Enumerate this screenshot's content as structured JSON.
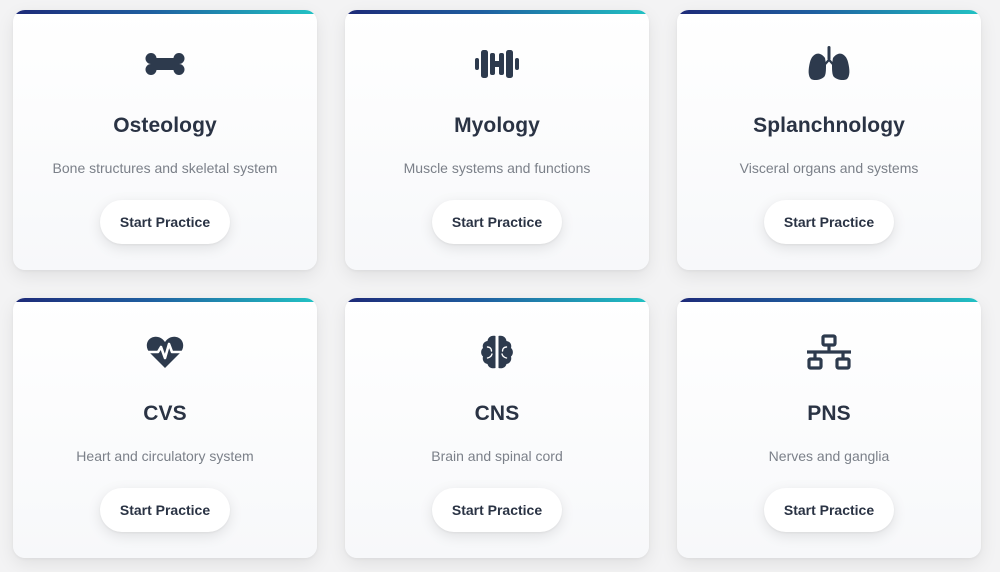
{
  "colors": {
    "icon": "#2d3a4d",
    "title": "#2a3344",
    "description": "#7b8089",
    "accent_start": "#1e2a78",
    "accent_end": "#22c3c4",
    "background": "#f3f3f4"
  },
  "cards": [
    {
      "icon": "bone-icon",
      "title": "Osteology",
      "description": "Bone structures and skeletal system",
      "button_label": "Start Practice"
    },
    {
      "icon": "dumbbell-icon",
      "title": "Myology",
      "description": "Muscle systems and functions",
      "button_label": "Start Practice"
    },
    {
      "icon": "lungs-icon",
      "title": "Splanchnology",
      "description": "Visceral organs and systems",
      "button_label": "Start Practice"
    },
    {
      "icon": "heart-pulse-icon",
      "title": "CVS",
      "description": "Heart and circulatory system",
      "button_label": "Start Practice"
    },
    {
      "icon": "brain-icon",
      "title": "CNS",
      "description": "Brain and spinal cord",
      "button_label": "Start Practice"
    },
    {
      "icon": "network-icon",
      "title": "PNS",
      "description": "Nerves and ganglia",
      "button_label": "Start Practice"
    }
  ]
}
